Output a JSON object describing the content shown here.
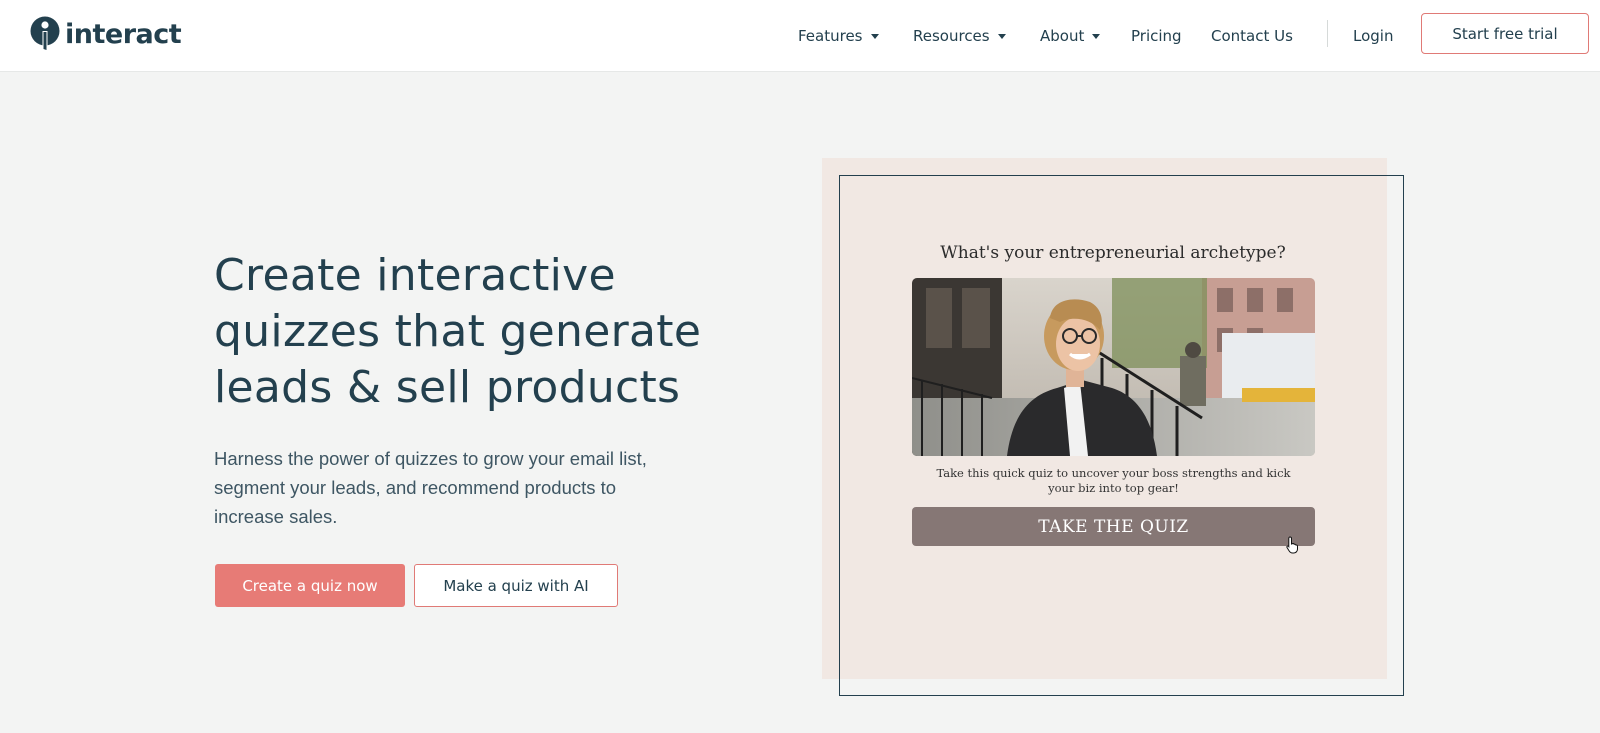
{
  "brand": {
    "name": "interact"
  },
  "nav": {
    "features": "Features",
    "resources": "Resources",
    "about": "About",
    "pricing": "Pricing",
    "contact": "Contact Us",
    "login": "Login",
    "trial": "Start free trial"
  },
  "hero": {
    "title": "Create interactive quizzes that generate leads & sell products",
    "subtitle": "Harness the power of quizzes to grow your email list, segment your leads, and recommend products to increase sales.",
    "primary_cta": "Create a quiz now",
    "secondary_cta": "Make a quiz with AI"
  },
  "quiz": {
    "title": "What's your entrepreneurial archetype?",
    "description": "Take this quick quiz to uncover your boss strengths and kick your biz into top gear!",
    "button": "TAKE THE QUIZ"
  },
  "colors": {
    "brand_dark": "#23404e",
    "accent_coral": "#e77b76",
    "quiz_button": "#867775",
    "quiz_background": "#f1e8e3",
    "page_background": "#f3f4f3"
  },
  "icons": [
    "interact-logo-icon",
    "chevron-down-icon",
    "pointer-cursor-icon"
  ]
}
